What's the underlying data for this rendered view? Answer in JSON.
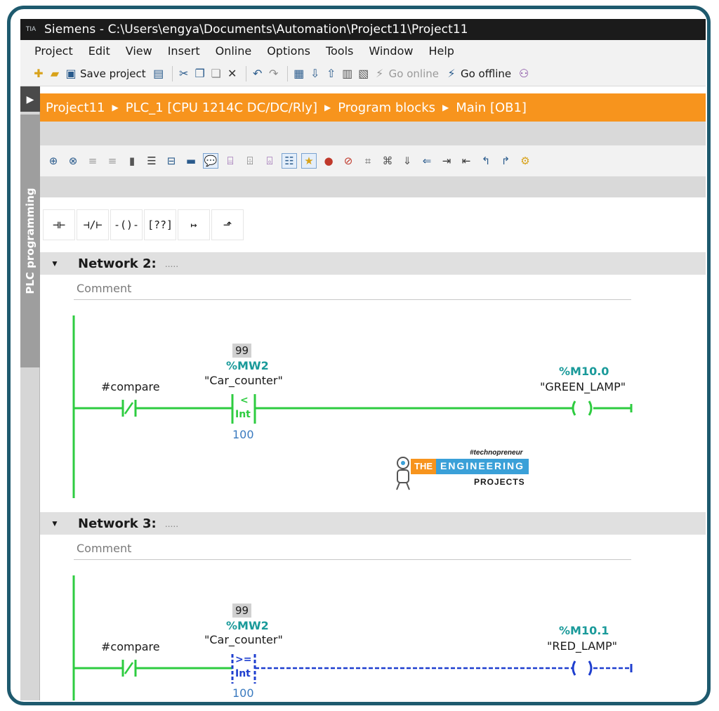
{
  "window": {
    "logo_text": "TIA",
    "title": "Siemens - C:\\Users\\engya\\Documents\\Automation\\Project11\\Project11"
  },
  "menu": [
    "Project",
    "Edit",
    "View",
    "Insert",
    "Online",
    "Options",
    "Tools",
    "Window",
    "Help"
  ],
  "toolbar": {
    "save_label": "Save project",
    "go_online_label": "Go online",
    "go_offline_label": "Go offline"
  },
  "sidebar": {
    "tab_label": "PLC programming"
  },
  "breadcrumb": [
    "Project11",
    "PLC_1 [CPU 1214C DC/DC/Rly]",
    "Program blocks",
    "Main [OB1]"
  ],
  "networks": [
    {
      "title": "Network 2:",
      "dots": ".....",
      "comment": "Comment",
      "contact_tag": "#compare",
      "compare_value": "99",
      "compare_address": "%MW2",
      "compare_tag": "\"Car_counter\"",
      "compare_op": "<",
      "compare_type": "Int",
      "compare_operand2": "100",
      "coil_address": "%M10.0",
      "coil_tag": "\"GREEN_LAMP\""
    },
    {
      "title": "Network 3:",
      "dots": ".....",
      "comment": "Comment",
      "contact_tag": "#compare",
      "compare_value": "99",
      "compare_address": "%MW2",
      "compare_tag": "\"Car_counter\"",
      "compare_op": ">=",
      "compare_type": "Int",
      "compare_operand2": "100",
      "coil_address": "%M10.1",
      "coil_tag": "\"RED_LAMP\""
    }
  ],
  "watermark": {
    "tag": "#technopreneur",
    "the": "THE",
    "engineering": "ENGINEERING",
    "projects": "PROJECTS"
  },
  "colors": {
    "energized": "#2ecc40",
    "de_energized": "#1f3fcf",
    "breadcrumb_bg": "#f7941d",
    "frame": "#1e5a6e"
  }
}
